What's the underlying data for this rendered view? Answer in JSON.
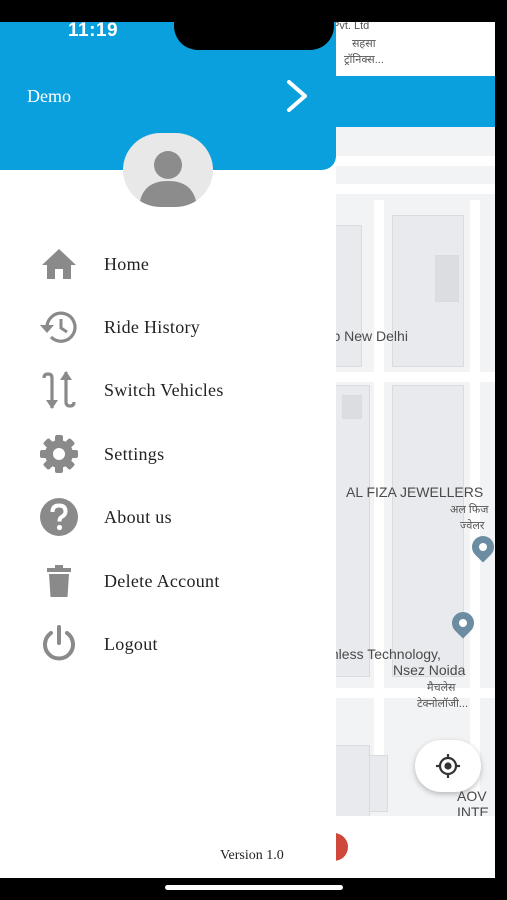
{
  "status_bar": {
    "time": "11:19"
  },
  "drawer": {
    "user_name": "Demo",
    "menu": [
      {
        "label": "Home",
        "icon": "home-icon"
      },
      {
        "label": "Ride History",
        "icon": "history-icon"
      },
      {
        "label": "Switch Vehicles",
        "icon": "swap-icon"
      },
      {
        "label": "Settings",
        "icon": "gear-icon"
      },
      {
        "label": "About us",
        "icon": "help-icon"
      },
      {
        "label": "Delete Account",
        "icon": "trash-icon"
      },
      {
        "label": "Logout",
        "icon": "power-icon"
      }
    ],
    "version": "Version 1.0"
  },
  "map": {
    "labels": {
      "top_line1": "Pvt. Ltd",
      "top_line2": "सहसा",
      "top_line3": "ट्रॉनिक्स...",
      "corp": "orp New Delhi",
      "jewellers": "AL FIZA JEWELLERS",
      "jewellers_hi1": "अल फिज",
      "jewellers_hi2": "ज्वेलर",
      "tech1": "tchless Technology,",
      "tech2": "Nsez Noida",
      "tech3": "मैचलेस",
      "tech4": "टेक्नोलॉजी...",
      "aov1": "AOV",
      "aov2": "INTE"
    }
  },
  "colors": {
    "primary": "#0aa0dd",
    "icon_gray": "#8a8a8a"
  }
}
